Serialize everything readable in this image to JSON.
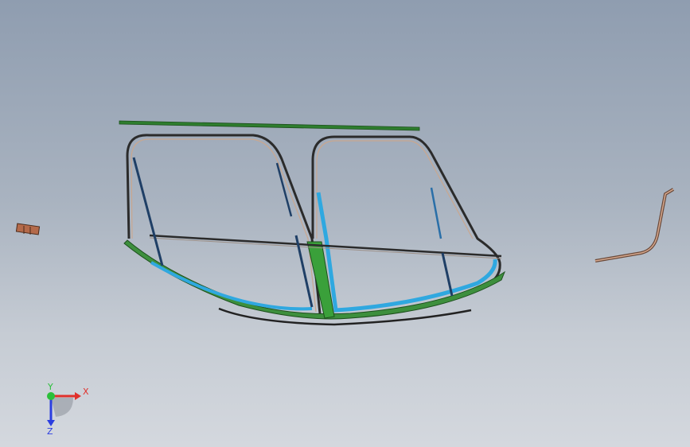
{
  "viewport": {
    "background_top": "#8f9db0",
    "background_bottom": "#d4d8de"
  },
  "model": {
    "frame_color": "#2b2b2b",
    "frame_highlight": "#c9a78f",
    "green_part_color": "#2e7d2e",
    "blue_part_color": "#2fa8e0",
    "strut_color": "#1f3f66",
    "copper_part_color": "#b46a4a"
  },
  "triad": {
    "x_label": "X",
    "y_label": "Y",
    "z_label": "Z",
    "x_color": "#e0302b",
    "y_color": "#2bbf3a",
    "z_color": "#2b3ee0"
  }
}
